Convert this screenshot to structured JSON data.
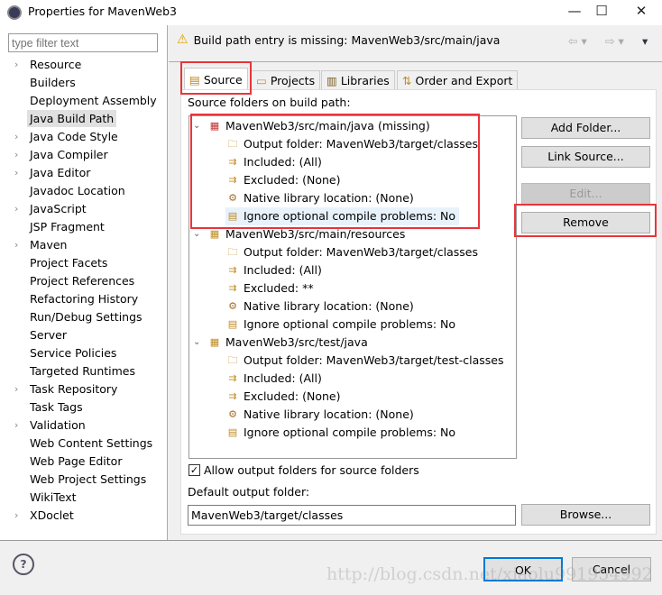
{
  "window": {
    "title": "Properties for MavenWeb3",
    "minimize": "—",
    "maximize": "☐",
    "close": "✕"
  },
  "filter": {
    "placeholder": "type filter text"
  },
  "nav": [
    {
      "label": "Resource",
      "expandable": true
    },
    {
      "label": "Builders"
    },
    {
      "label": "Deployment Assembly"
    },
    {
      "label": "Java Build Path",
      "selected": true
    },
    {
      "label": "Java Code Style",
      "expandable": true
    },
    {
      "label": "Java Compiler",
      "expandable": true
    },
    {
      "label": "Java Editor",
      "expandable": true
    },
    {
      "label": "Javadoc Location"
    },
    {
      "label": "JavaScript",
      "expandable": true
    },
    {
      "label": "JSP Fragment"
    },
    {
      "label": "Maven",
      "expandable": true
    },
    {
      "label": "Project Facets"
    },
    {
      "label": "Project References"
    },
    {
      "label": "Refactoring History"
    },
    {
      "label": "Run/Debug Settings"
    },
    {
      "label": "Server"
    },
    {
      "label": "Service Policies"
    },
    {
      "label": "Targeted Runtimes"
    },
    {
      "label": "Task Repository",
      "expandable": true
    },
    {
      "label": "Task Tags"
    },
    {
      "label": "Validation",
      "expandable": true
    },
    {
      "label": "Web Content Settings"
    },
    {
      "label": "Web Page Editor"
    },
    {
      "label": "Web Project Settings"
    },
    {
      "label": "WikiText"
    },
    {
      "label": "XDoclet",
      "expandable": true
    }
  ],
  "header": {
    "message": "Build path entry is missing: MavenWeb3/src/main/java"
  },
  "tabs": [
    {
      "label": "Source",
      "active": true
    },
    {
      "label": "Projects"
    },
    {
      "label": "Libraries"
    },
    {
      "label": "Order and Export"
    }
  ],
  "source": {
    "label": "Source folders on build path:",
    "folders": [
      {
        "label": "MavenWeb3/src/main/java (missing)",
        "children": [
          "Output folder: MavenWeb3/target/classes",
          "Included: (All)",
          "Excluded: (None)",
          "Native library location: (None)",
          "Ignore optional compile problems: No"
        ]
      },
      {
        "label": "MavenWeb3/src/main/resources",
        "children": [
          "Output folder: MavenWeb3/target/classes",
          "Included: (All)",
          "Excluded: **",
          "Native library location: (None)",
          "Ignore optional compile problems: No"
        ]
      },
      {
        "label": "MavenWeb3/src/test/java",
        "children": [
          "Output folder: MavenWeb3/target/test-classes",
          "Included: (All)",
          "Excluded: (None)",
          "Native library location: (None)",
          "Ignore optional compile problems: No"
        ]
      }
    ],
    "buttons": {
      "add_folder": "Add Folder...",
      "link_source": "Link Source...",
      "edit": "Edit...",
      "remove": "Remove"
    },
    "allow_output_label": "Allow output folders for source folders",
    "allow_output_checked": true,
    "default_output_label": "Default output folder:",
    "default_output_value": "MavenWeb3/target/classes",
    "browse": "Browse..."
  },
  "footer": {
    "ok": "OK",
    "cancel": "Cancel"
  },
  "watermark": "http://blog.csdn.net/xiaolu991954992",
  "colors": {
    "highlight": "#e8353a",
    "ok_border": "#0078d7"
  }
}
